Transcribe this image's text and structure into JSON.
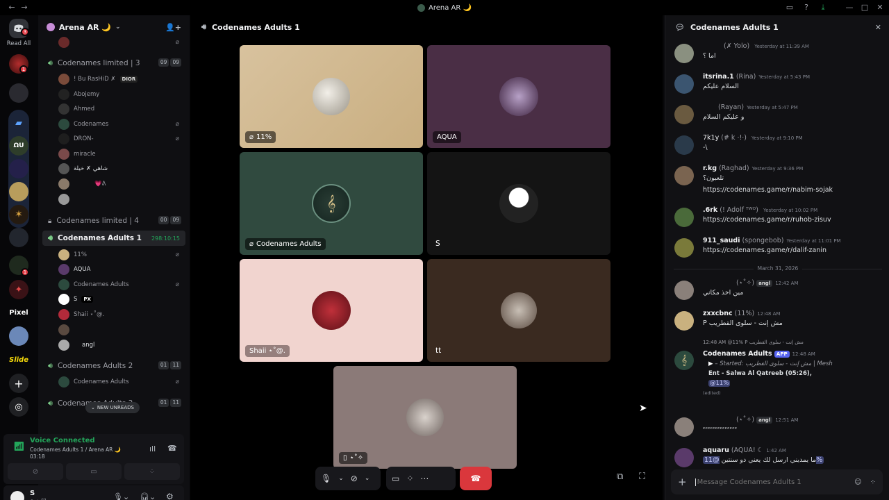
{
  "window": {
    "title": "Arena AR 🌙"
  },
  "rail": {
    "read_all": "Read All",
    "badge_1": "3",
    "badge_2": "1",
    "badge_3": "1",
    "pixel_label": "Pixel",
    "slide_label": "Slide",
    "icon_label": "ΩU"
  },
  "sidebar": {
    "server_name": "Arena AR 🌙",
    "channels": [
      {
        "name": "Codenames limited | 3",
        "pill_a": "09",
        "pill_b": "09"
      },
      {
        "name": "Codenames limited | 4",
        "pill_a": "00",
        "pill_b": "09"
      },
      {
        "name": "Codenames Adults 1",
        "timer": "298:10:15"
      },
      {
        "name": "Codenames Adults 2",
        "pill_a": "01",
        "pill_b": "11"
      },
      {
        "name": "Codenames Adults 3",
        "pill_a": "01",
        "pill_b": "11"
      }
    ],
    "limited3_users": [
      "! Bu RasHiD ✗",
      "Abojemy",
      "Ahmed",
      "Codenames",
      "DRON-",
      "miracle",
      "شاهي ✗ خيلة",
      "",
      ""
    ],
    "limited3_tags": {
      "dior": "DIOR",
      "heart": "💗ᕕ"
    },
    "adults1_users": [
      "11%",
      "AQUA",
      "Codenames Adults",
      "S",
      "Shaii ⋆˚@.",
      "",
      ""
    ],
    "adults1_tags": {
      "px": "PX",
      "angl": "angl"
    },
    "adults2_users": [
      "Codenames Adults"
    ],
    "new_unreads": "NEW UNREADS",
    "voice": {
      "status": "Voice Connected",
      "channel": "Codenames Adults 1 / Arena AR 🌙",
      "elapsed": "03:18"
    },
    "me": {
      "name": "S"
    }
  },
  "stage": {
    "title": "Codenames Adults 1",
    "tiles": [
      {
        "label": "11%"
      },
      {
        "label": "AQUA"
      },
      {
        "label": "Codenames Adults"
      },
      {
        "label": "S"
      },
      {
        "label": "Shaii ⋆˚@."
      },
      {
        "label": "tt"
      },
      {
        "label": "⋆˚✧"
      }
    ]
  },
  "chat": {
    "title": "Codenames Adults 1",
    "composer_placeholder": "Message Codenames Adults 1",
    "date_separator": "March 31, 2026",
    "messages": [
      {
        "author": "",
        "sub": "(✗ Yolo) ",
        "time": "Yesterday at 11:39 AM",
        "text": "اما ؟"
      },
      {
        "author": "itsrina.1",
        "sub": " (Rina)",
        "time": "Yesterday at 5:43 PM",
        "text": "السلام عليكم"
      },
      {
        "author": "",
        "sub": "(Rayan)",
        "time": "Yesterday at 5:47 PM",
        "text": "و عليكم السلام"
      },
      {
        "author": "7k1y",
        "sub": " (# k ⋅!⋅) ",
        "time": "Yesterday at 9:10 PM",
        "text": "-\\"
      },
      {
        "author": "r.kg",
        "sub": " (Raghad)",
        "time": "Yesterday at 9:36 PM",
        "text": "تلعبون؟",
        "link": "https://codenames.game/r/nabim-sojak"
      },
      {
        "author": ".6rk",
        "sub": " (! Adolf ᵀᵂᴼ) ",
        "time": "Yesterday at 10:02 PM",
        "link": "https://codenames.game/r/ruhob-zisuv"
      },
      {
        "author": "911_saudi",
        "sub": " (spongebob)",
        "time": "Yesterday at 11:01 PM",
        "link": "https://codenames.game/r/dalif-zanin"
      },
      {
        "author": "",
        "sub": "(⋆˚✧) ",
        "tag": "angl",
        "time": "12:42 AM",
        "text": "مين اخذ مكاني"
      },
      {
        "author": "zxxcbnc",
        "sub": " (11%)",
        "time": "12:48 AM",
        "text": "P مش إنت - سلوى القطريب"
      },
      {
        "reply": "@11% P مش إنت - سلوى القطريب",
        "reply_time": "12:48 AM",
        "author": "Codenames Adults",
        "app": "APP",
        "time": "12:48 AM",
        "line1": "– Started: مش إنت - سلوى القطريب | Mesh",
        "line2": "Ent - Salwa Al Qatreeb (05:26),",
        "mention": "@11%",
        "edited": "(edited)"
      },
      {
        "author": "",
        "sub": "(⋆˚✧) ",
        "tag": "angl",
        "time": "12:51 AM",
        "text": "ᶜᶜᶜᶜᶜᶜᶜᶜᶜᶜᶜᶜᶜᶜ"
      },
      {
        "author": "aquaru",
        "sub": " (AQUA! ☾",
        "time": "1:42 AM",
        "text": "ما يمديني ارسل لك يعني دو سنتين",
        "mention": "@11%"
      }
    ]
  },
  "colors": {
    "accent": "#5865f2",
    "green": "#23a55a",
    "red": "#da373c",
    "link": "#3e9ce8"
  }
}
